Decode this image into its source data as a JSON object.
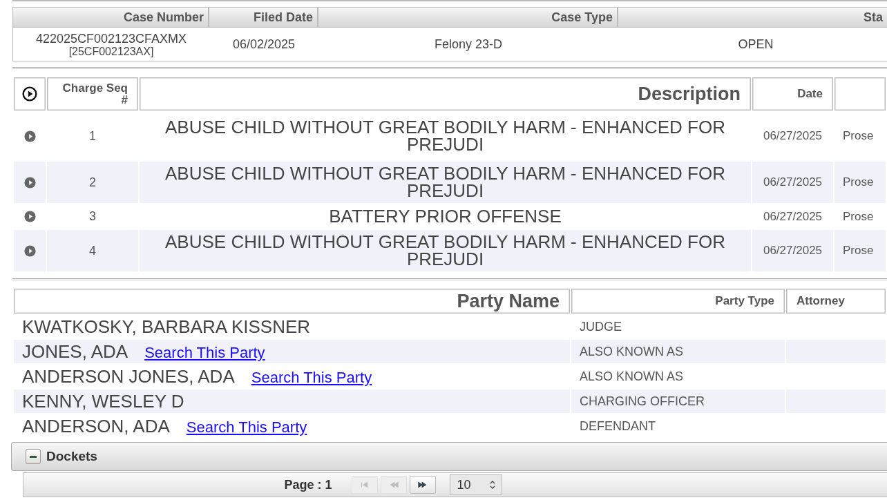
{
  "case": {
    "columns": [
      "Case Number",
      "Filed Date",
      "Case Type",
      "Sta"
    ],
    "row": {
      "case_number": "422025CF002123CFAXMX",
      "case_number_alt": "[25CF002123AX]",
      "filed_date": "06/02/2025",
      "case_type": "Felony 23-D",
      "status": "OPEN"
    }
  },
  "charges": {
    "columns": [
      "Charge Seq #",
      "Description",
      "Date"
    ],
    "rows": [
      {
        "seq": "1",
        "description": "ABUSE CHILD WITHOUT GREAT BODILY HARM - ENHANCED FOR PREJUDI",
        "date": "06/27/2025",
        "column_5": "Prose"
      },
      {
        "seq": "2",
        "description": "ABUSE CHILD WITHOUT GREAT BODILY HARM - ENHANCED FOR PREJUDI",
        "date": "06/27/2025",
        "column_5": "Prose"
      },
      {
        "seq": "3",
        "description": "BATTERY PRIOR OFFENSE",
        "date": "06/27/2025",
        "column_5": "Prose"
      },
      {
        "seq": "4",
        "description": "ABUSE CHILD WITHOUT GREAT BODILY HARM - ENHANCED FOR PREJUDI",
        "date": "06/27/2025",
        "column_5": "Prose"
      }
    ]
  },
  "parties": {
    "columns": [
      "Party Name",
      "Party Type",
      "Attorney"
    ],
    "rows": [
      {
        "name": "KWATKOSKY, BARBARA KISSNER",
        "party_type": "JUDGE"
      },
      {
        "name": "JONES, ADA",
        "link": "Search This Party",
        "party_type": "ALSO KNOWN AS"
      },
      {
        "name": "ANDERSON JONES, ADA",
        "link": "Search This Party",
        "party_type": "ALSO KNOWN AS"
      },
      {
        "name": "KENNY, WESLEY D",
        "party_type": "CHARGING OFFICER"
      },
      {
        "name": "ANDERSON, ADA",
        "link": "Search This Party",
        "party_type": "DEFENDANT"
      }
    ]
  },
  "dockets": {
    "title": "Dockets",
    "expanded": true
  },
  "pager": {
    "page_label": "Page : 1",
    "buttons": [
      {
        "kind": "first",
        "disabled": true
      },
      {
        "kind": "prev",
        "disabled": true
      },
      {
        "kind": "next",
        "disabled": false
      }
    ],
    "page_size": "10"
  }
}
